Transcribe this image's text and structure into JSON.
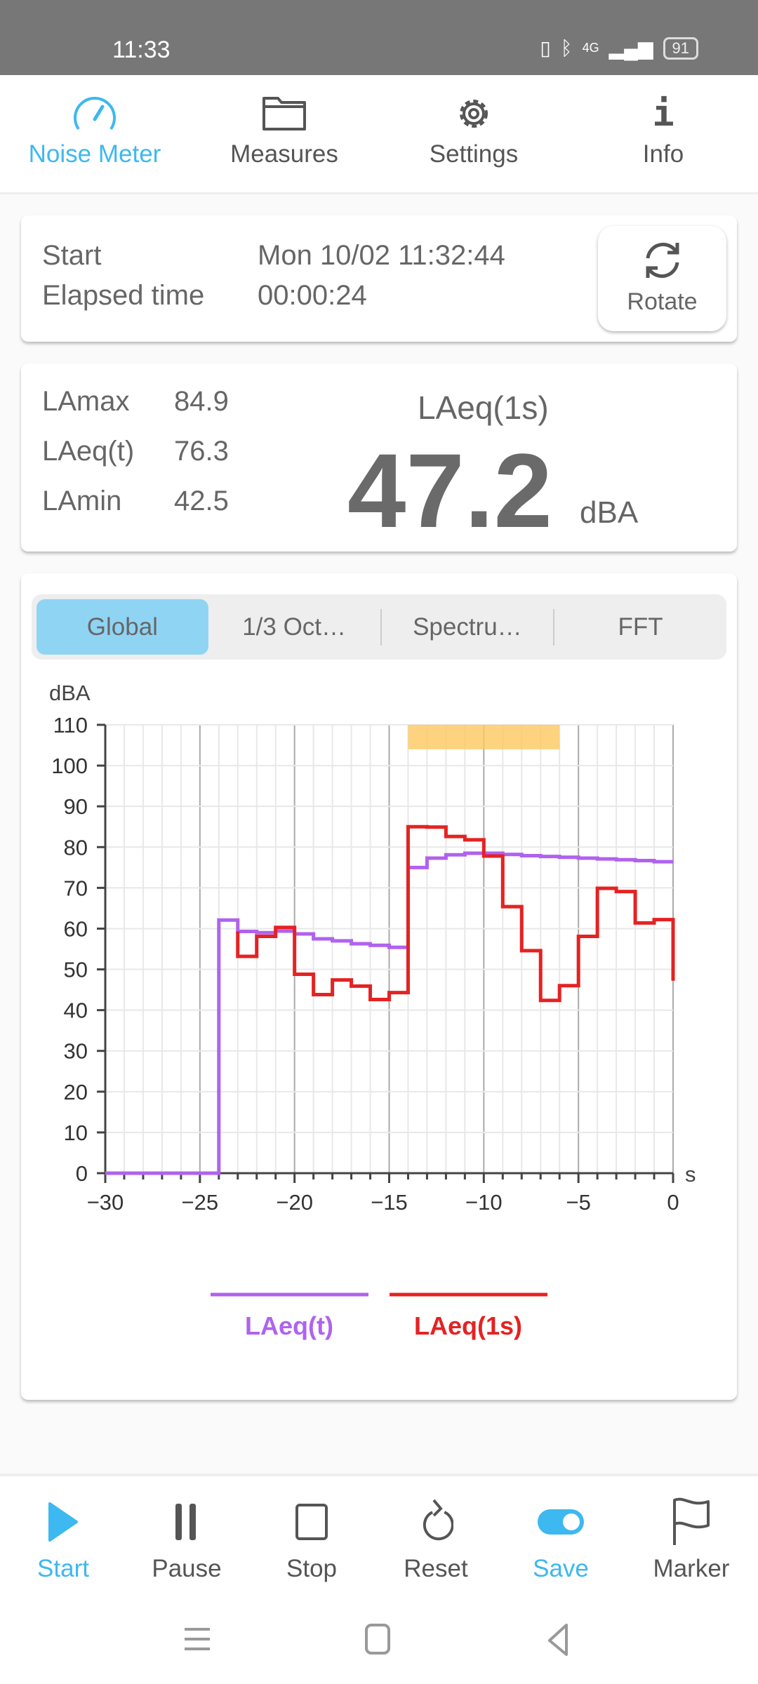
{
  "status_bar": {
    "time": "11:33",
    "network": "4G",
    "battery": "91"
  },
  "top_nav": {
    "items": [
      {
        "label": "Noise Meter",
        "icon": "speedometer-icon",
        "active": true
      },
      {
        "label": "Measures",
        "icon": "folder-icon"
      },
      {
        "label": "Settings",
        "icon": "gear-icon"
      },
      {
        "label": "Info",
        "icon": "info-icon"
      }
    ]
  },
  "session": {
    "start_label": "Start",
    "start_value": "Mon 10/02 11:32:44",
    "elapsed_label": "Elapsed time",
    "elapsed_value": "00:00:24",
    "rotate_label": "Rotate"
  },
  "levels": {
    "lamax_label": "LAmax",
    "lamax_value": "84.9",
    "laeqt_label": "LAeq(t)",
    "laeqt_value": "76.3",
    "lamin_label": "LAmin",
    "lamin_value": "42.5",
    "main_label": "LAeq(1s)",
    "main_value": "47.2",
    "main_unit": "dBA"
  },
  "chart_tabs": [
    {
      "label": "Global",
      "selected": true
    },
    {
      "label": "1/3 Oct…"
    },
    {
      "label": "Spectru…"
    },
    {
      "label": "FFT"
    }
  ],
  "chart_data": {
    "type": "line",
    "ylabel": "dBA",
    "xlabel": "s",
    "xlim": [
      -30,
      0
    ],
    "ylim": [
      0,
      110
    ],
    "xticks": [
      -30,
      -25,
      -20,
      -15,
      -10,
      -5,
      0
    ],
    "yticks": [
      0,
      10,
      20,
      30,
      40,
      50,
      60,
      70,
      80,
      90,
      100,
      110
    ],
    "grid": true,
    "step": true,
    "legend_position": "bottom",
    "marker_band": {
      "x_from": -14,
      "x_to": -6,
      "color": "#fdc85f"
    },
    "series": [
      {
        "name": "LAeq(t)",
        "color": "#b062ee",
        "x_start": -30,
        "values": [
          0,
          0,
          0,
          0,
          0,
          0,
          62.1,
          59.3,
          59.0,
          59.4,
          58.7,
          57.5,
          57.0,
          56.3,
          55.9,
          55.4,
          75.0,
          77.3,
          78.1,
          78.5,
          78.5,
          78.2,
          77.9,
          77.7,
          77.5,
          77.3,
          77.1,
          76.9,
          76.7,
          76.4
        ]
      },
      {
        "name": "LAeq(1s)",
        "color": "#e52222",
        "x_start": -23,
        "values": [
          53.2,
          58.1,
          60.3,
          48.8,
          43.8,
          47.4,
          45.9,
          42.6,
          44.3,
          85.0,
          84.9,
          82.6,
          81.8,
          77.8,
          65.4,
          54.6,
          42.4,
          46.0,
          58.1,
          69.9,
          69.1,
          61.4,
          62.2
        ],
        "current": 47.2
      }
    ]
  },
  "bottom_bar": {
    "items": [
      {
        "label": "Start",
        "icon": "play-icon",
        "color": "#3db8f0"
      },
      {
        "label": "Pause",
        "icon": "pause-icon"
      },
      {
        "label": "Stop",
        "icon": "stop-icon"
      },
      {
        "label": "Reset",
        "icon": "reset-icon"
      },
      {
        "label": "Save",
        "icon": "toggle-on-icon",
        "color": "#3db8f0"
      },
      {
        "label": "Marker",
        "icon": "flag-icon"
      }
    ]
  }
}
